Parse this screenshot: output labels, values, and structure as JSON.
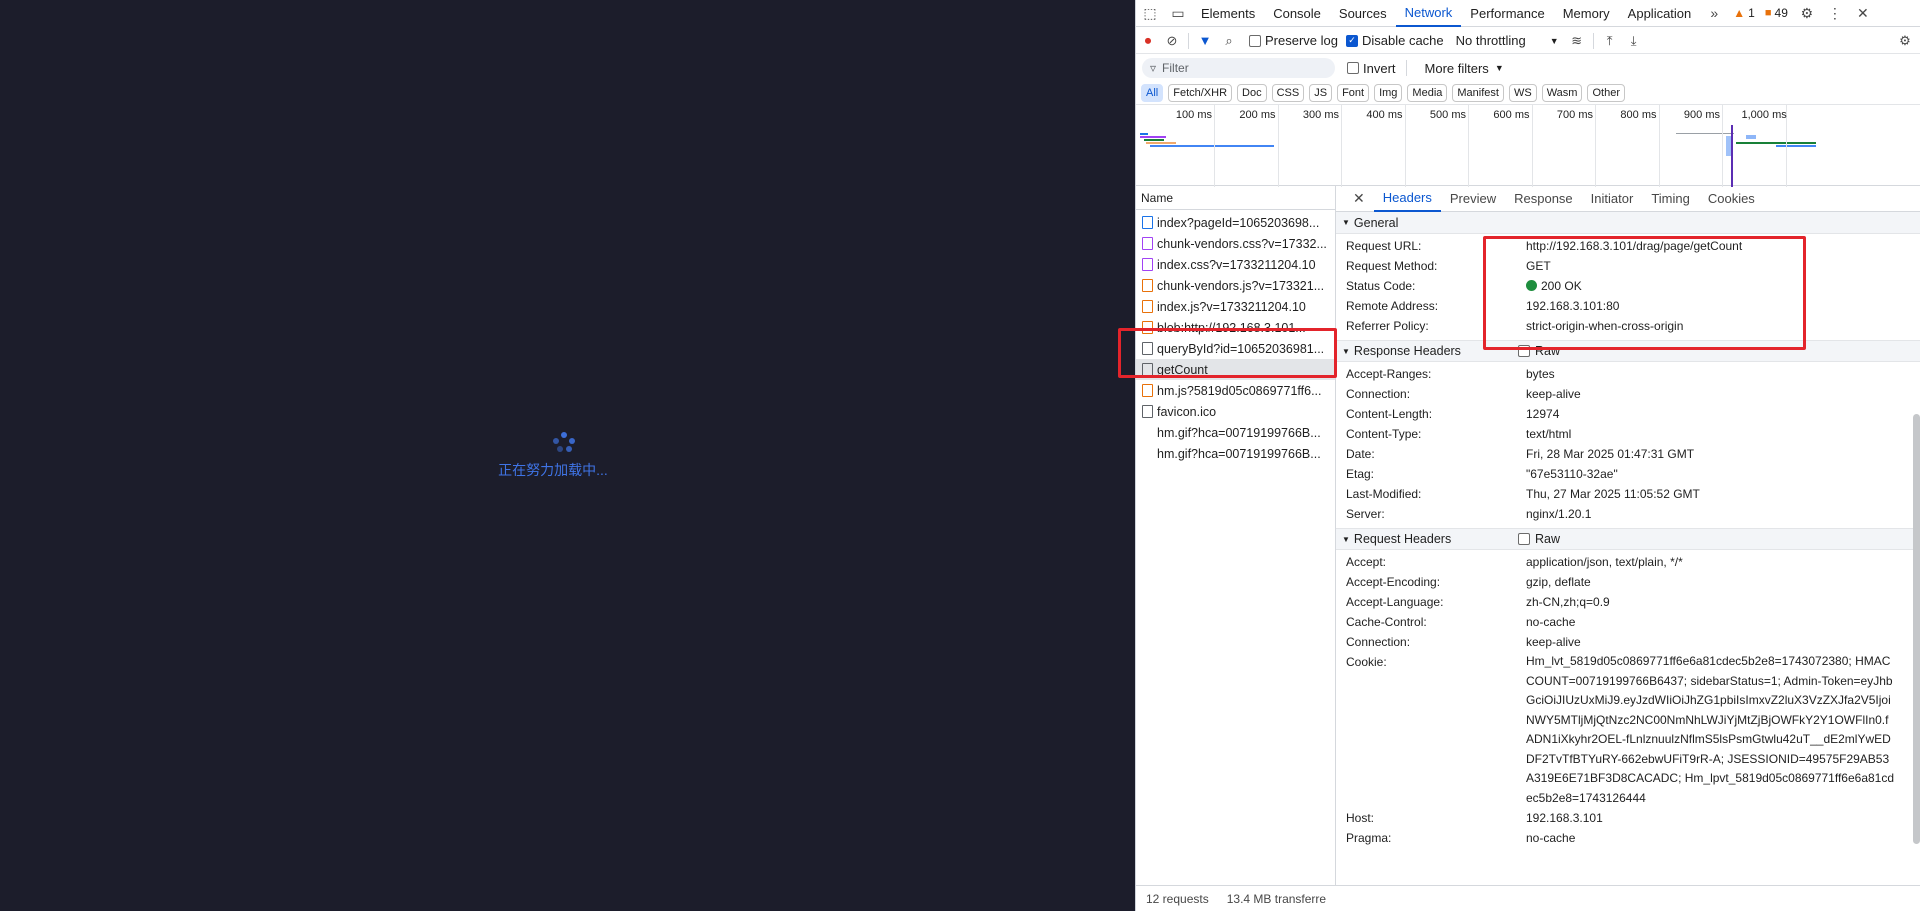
{
  "page": {
    "loading_text": "正在努力加载中..."
  },
  "devtools": {
    "tabs": [
      "Elements",
      "Console",
      "Sources",
      "Network",
      "Performance",
      "Memory",
      "Application"
    ],
    "active_tab": "Network",
    "warning_count": "1",
    "message_count": "49",
    "toolbar": {
      "preserve_log": "Preserve log",
      "disable_cache": "Disable cache",
      "throttling": "No throttling"
    },
    "filter": {
      "placeholder": "Filter",
      "invert": "Invert",
      "more_filters": "More filters"
    },
    "types": [
      "All",
      "Fetch/XHR",
      "Doc",
      "CSS",
      "JS",
      "Font",
      "Img",
      "Media",
      "Manifest",
      "WS",
      "Wasm",
      "Other"
    ],
    "timeline_ticks": [
      "100 ms",
      "200 ms",
      "300 ms",
      "400 ms",
      "500 ms",
      "600 ms",
      "700 ms",
      "800 ms",
      "900 ms",
      "1,000 ms"
    ],
    "list": {
      "header": "Name",
      "items": [
        {
          "name": "index?pageId=1065203698...",
          "type": "doc"
        },
        {
          "name": "chunk-vendors.css?v=17332...",
          "type": "css"
        },
        {
          "name": "index.css?v=1733211204.10",
          "type": "css"
        },
        {
          "name": "chunk-vendors.js?v=173321...",
          "type": "js"
        },
        {
          "name": "index.js?v=1733211204.10",
          "type": "js"
        },
        {
          "name": "blob:http://192.168.3.101...",
          "type": "js"
        },
        {
          "name": "queryById?id=10652036981...",
          "type": "file"
        },
        {
          "name": "getCount",
          "type": "file"
        },
        {
          "name": "hm.js?5819d05c0869771ff6...",
          "type": "js"
        },
        {
          "name": "favicon.ico",
          "type": "file"
        },
        {
          "name": "hm.gif?hca=00719199766B...",
          "type": "none"
        },
        {
          "name": "hm.gif?hca=00719199766B...",
          "type": "none"
        }
      ]
    },
    "footer": {
      "requests": "12 requests",
      "transferred": "13.4 MB transferre"
    },
    "details": {
      "tabs": [
        "Headers",
        "Preview",
        "Response",
        "Initiator",
        "Timing",
        "Cookies"
      ],
      "active_tab": "Headers",
      "general_title": "General",
      "general": [
        {
          "k": "Request URL:",
          "v": "http://192.168.3.101/drag/page/getCount"
        },
        {
          "k": "Request Method:",
          "v": "GET"
        },
        {
          "k": "Status Code:",
          "v": "200 OK"
        },
        {
          "k": "Remote Address:",
          "v": "192.168.3.101:80"
        },
        {
          "k": "Referrer Policy:",
          "v": "strict-origin-when-cross-origin"
        }
      ],
      "response_title": "Response Headers",
      "raw_label": "Raw",
      "response": [
        {
          "k": "Accept-Ranges:",
          "v": "bytes"
        },
        {
          "k": "Connection:",
          "v": "keep-alive"
        },
        {
          "k": "Content-Length:",
          "v": "12974"
        },
        {
          "k": "Content-Type:",
          "v": "text/html"
        },
        {
          "k": "Date:",
          "v": "Fri, 28 Mar 2025 01:47:31 GMT"
        },
        {
          "k": "Etag:",
          "v": "\"67e53110-32ae\""
        },
        {
          "k": "Last-Modified:",
          "v": "Thu, 27 Mar 2025 11:05:52 GMT"
        },
        {
          "k": "Server:",
          "v": "nginx/1.20.1"
        }
      ],
      "request_title": "Request Headers",
      "request": [
        {
          "k": "Accept:",
          "v": "application/json, text/plain, */*"
        },
        {
          "k": "Accept-Encoding:",
          "v": "gzip, deflate"
        },
        {
          "k": "Accept-Language:",
          "v": "zh-CN,zh;q=0.9"
        },
        {
          "k": "Cache-Control:",
          "v": "no-cache"
        },
        {
          "k": "Connection:",
          "v": "keep-alive"
        },
        {
          "k": "Cookie:",
          "v": "Hm_lvt_5819d05c0869771ff6e6a81cdec5b2e8=1743072380; HMACCOUNT=00719199766B6437; sidebarStatus=1; Admin-Token=eyJhbGciOiJIUzUxMiJ9.eyJzdWIiOiJhZG1pbiIsImxvZ2luX3VzZXJfa2V5IjoiNWY5MTljMjQtNzc2NC00NmNhLWJiYjMtZjBjOWFkY2Y1OWFlIn0.fADN1iXkyhr2OEL-fLnlznuulzNflmS5lsPsmGtwlu42uT__dE2mlYwEDDF2TvTfBTYuRY-662ebwUFiT9rR-A; JSESSIONID=49575F29AB53A319E6E71BF3D8CACADC; Hm_lpvt_5819d05c0869771ff6e6a81cdec5b2e8=1743126444"
        },
        {
          "k": "Host:",
          "v": "192.168.3.101"
        },
        {
          "k": "Pragma:",
          "v": "no-cache"
        }
      ]
    }
  },
  "colors": {
    "page_bg": "#1c1d2b",
    "accent": "#0b57d0",
    "highlight_box": "#e3242b",
    "status_ok": "#1e8e3e"
  }
}
